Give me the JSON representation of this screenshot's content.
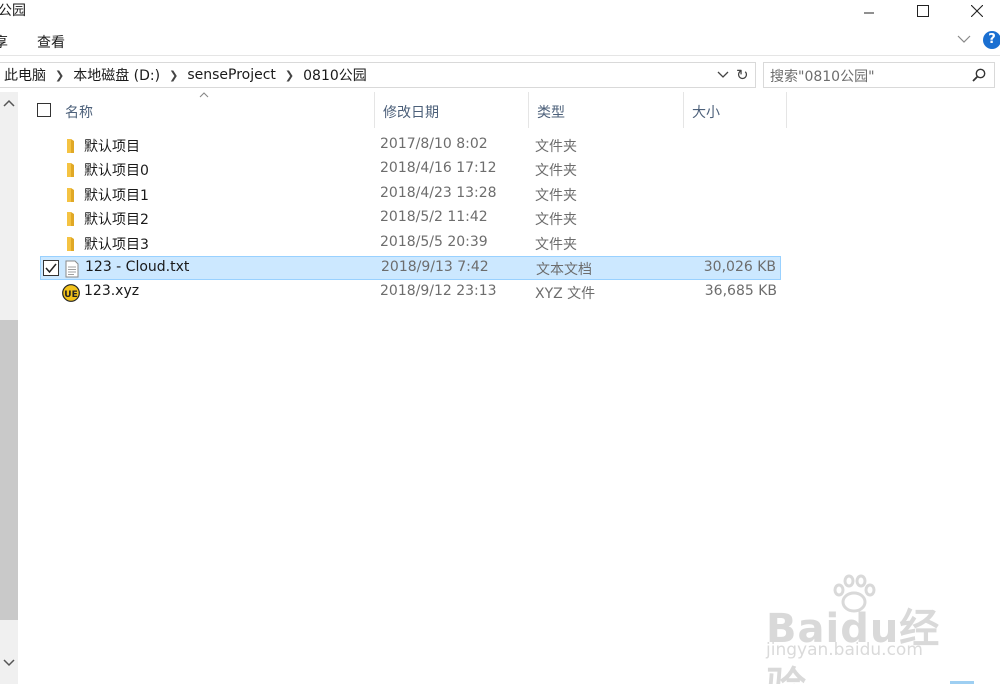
{
  "window": {
    "title": "公园",
    "controls": {
      "minimize": "minimize",
      "maximize": "maximize",
      "close": "close"
    }
  },
  "ribbon": {
    "tabs": [
      "享",
      "查看"
    ],
    "expand_icon": "chevron-down-icon",
    "help_label": "?"
  },
  "address": {
    "crumbs": [
      "此电脑",
      "本地磁盘 (D:)",
      "senseProject",
      "0810公园"
    ]
  },
  "search": {
    "placeholder": "搜索\"0810公园\""
  },
  "columns": {
    "name": "名称",
    "modified": "修改日期",
    "type": "类型",
    "size": "大小"
  },
  "files": [
    {
      "name": "默认项目",
      "modified": "2017/8/10 8:02",
      "type": "文件夹",
      "size": "",
      "icon": "folder-icon",
      "selected": false
    },
    {
      "name": "默认项目0",
      "modified": "2018/4/16 17:12",
      "type": "文件夹",
      "size": "",
      "icon": "folder-icon",
      "selected": false
    },
    {
      "name": "默认项目1",
      "modified": "2018/4/23 13:28",
      "type": "文件夹",
      "size": "",
      "icon": "folder-icon",
      "selected": false
    },
    {
      "name": "默认项目2",
      "modified": "2018/5/2 11:42",
      "type": "文件夹",
      "size": "",
      "icon": "folder-icon",
      "selected": false
    },
    {
      "name": "默认项目3",
      "modified": "2018/5/5 20:39",
      "type": "文件夹",
      "size": "",
      "icon": "folder-icon",
      "selected": false
    },
    {
      "name": "123 - Cloud.txt",
      "modified": "2018/9/13 7:42",
      "type": "文本文档",
      "size": "30,026 KB",
      "icon": "text-file-icon",
      "selected": true
    },
    {
      "name": "123.xyz",
      "modified": "2018/9/12 23:13",
      "type": "XYZ 文件",
      "size": "36,685 KB",
      "icon": "ultraedit-file-icon",
      "selected": false
    }
  ],
  "watermark": {
    "brand": "Baidu经验",
    "url": "jingyan.baidu.com"
  },
  "colors": {
    "selection": "#cce8ff",
    "selection_border": "#99d1ff",
    "folder": "#f5c342",
    "header_text": "#4c607a",
    "help": "#1a6fd1"
  }
}
